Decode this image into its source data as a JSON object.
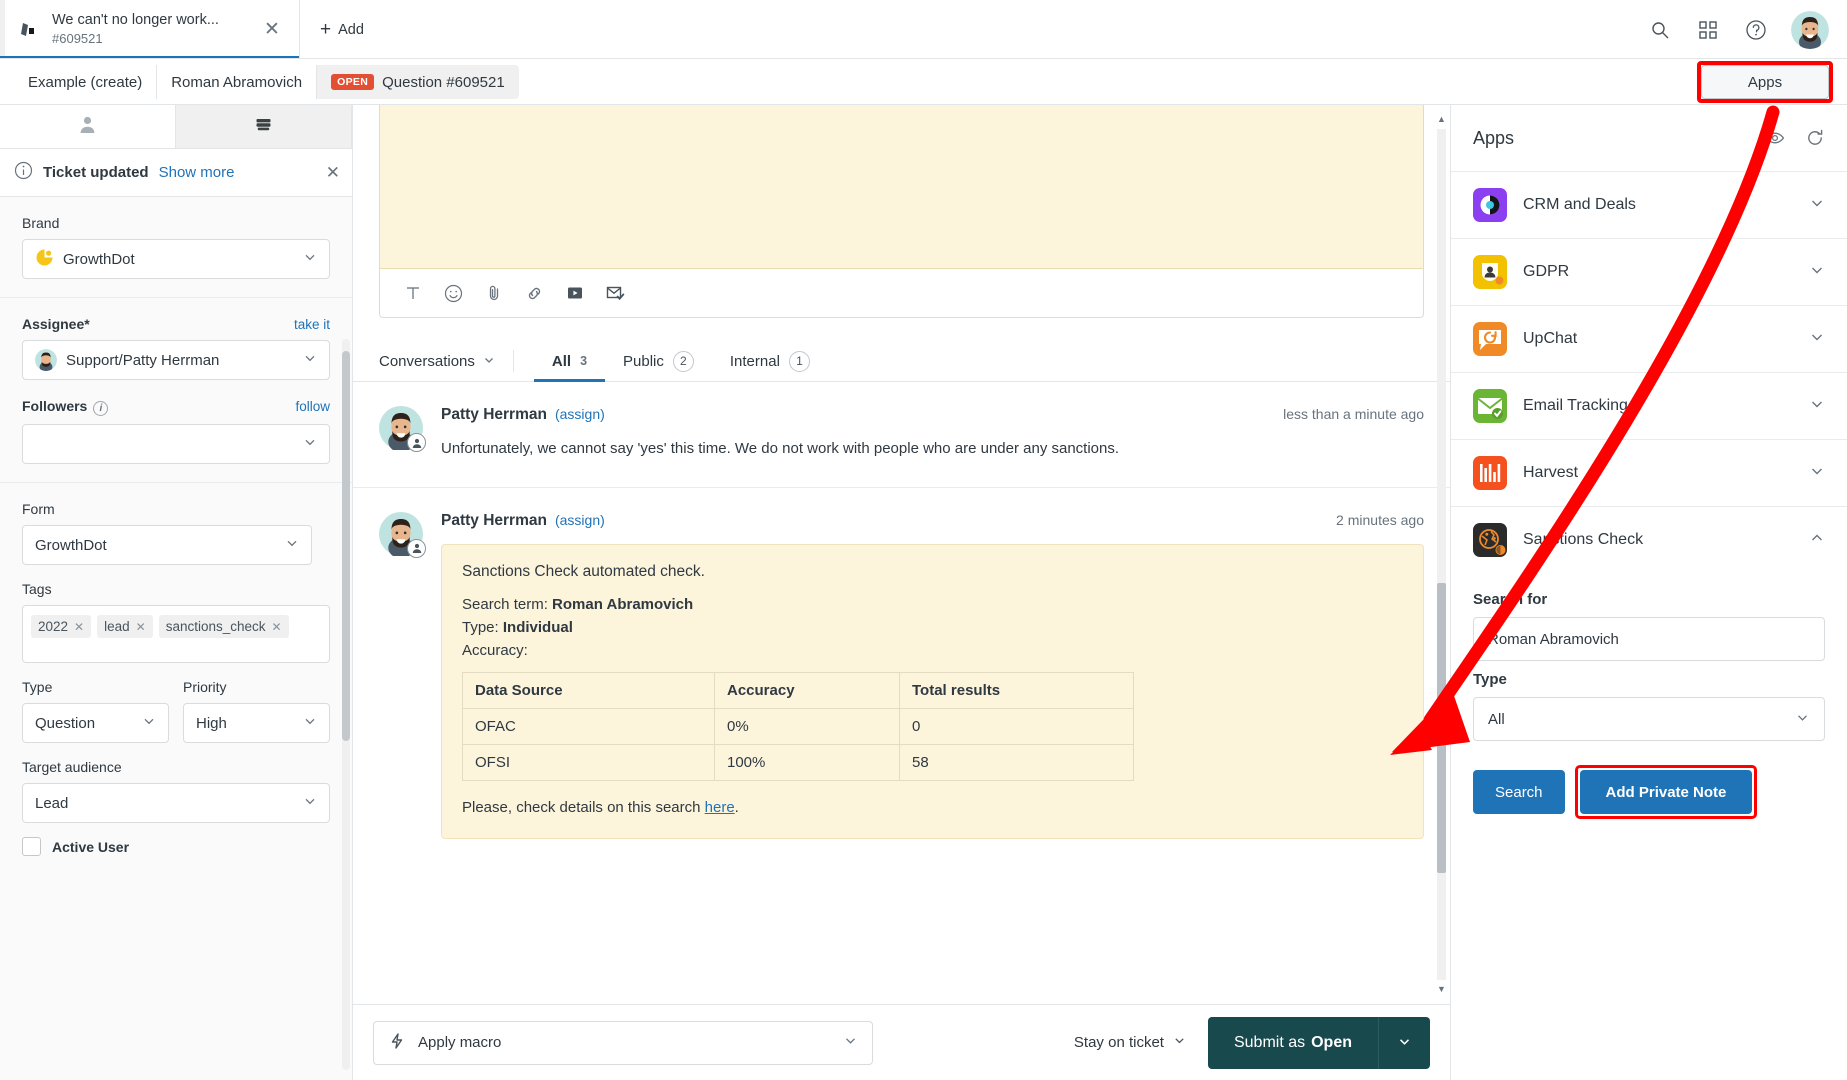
{
  "topbar": {
    "ticket_tab": {
      "title": "We can't no longer work...",
      "number": "#609521",
      "close_icon": "close-icon"
    },
    "add_label": "Add",
    "icons": {
      "search": "search-icon",
      "grid": "grid-icon",
      "help": "help-icon",
      "avatar": "user-avatar"
    }
  },
  "breadcrumb": {
    "items": [
      {
        "label": "Example (create)",
        "badge": "",
        "active": false
      },
      {
        "label": "Roman Abramovich",
        "badge": "",
        "active": false
      },
      {
        "label": "Question #609521",
        "badge": "OPEN",
        "active": true
      }
    ],
    "apps_button": "Apps"
  },
  "left_panel": {
    "tabs": [
      {
        "name": "user-tab",
        "icon": "user-icon",
        "active": false
      },
      {
        "name": "ticket-tab",
        "icon": "ticket-icon",
        "active": true
      }
    ],
    "notice": {
      "title": "Ticket updated",
      "link": "Show more",
      "close": "close-icon"
    },
    "brand": {
      "label": "Brand",
      "value": "GrowthDot"
    },
    "assignee": {
      "label": "Assignee*",
      "action": "take it",
      "value": "Support/Patty Herrman"
    },
    "followers": {
      "label": "Followers",
      "action": "follow",
      "value": ""
    },
    "form": {
      "label": "Form",
      "value": "GrowthDot"
    },
    "tags": {
      "label": "Tags",
      "items": [
        "2022",
        "lead",
        "sanctions_check"
      ]
    },
    "type": {
      "label": "Type",
      "value": "Question"
    },
    "priority": {
      "label": "Priority",
      "value": "High"
    },
    "target_audience": {
      "label": "Target audience",
      "value": "Lead"
    },
    "active_user": {
      "label": "Active User",
      "checked": false
    }
  },
  "center": {
    "composer_tools": [
      "text-format-icon",
      "emoji-icon",
      "attachment-icon",
      "link-icon",
      "video-icon",
      "email-icon"
    ],
    "conversations_label": "Conversations",
    "tabs": [
      {
        "label": "All",
        "count": "3",
        "style": "plain",
        "active": true
      },
      {
        "label": "Public",
        "count": "2",
        "style": "circle",
        "active": false
      },
      {
        "label": "Internal",
        "count": "1",
        "style": "circle",
        "active": false
      }
    ],
    "messages": [
      {
        "author": "Patty Herrman",
        "assign": "(assign)",
        "time": "less than a minute ago",
        "text": "Unfortunately, we cannot say 'yes' this time. We do not work with people who are under any sanctions."
      },
      {
        "author": "Patty Herrman",
        "assign": "(assign)",
        "time": "2 minutes ago",
        "note": {
          "title": "Sanctions Check automated check.",
          "search_term_label": "Search term:",
          "search_term_value": "Roman Abramovich",
          "type_label": "Type:",
          "type_value": "Individual",
          "accuracy_label": "Accuracy:",
          "table": {
            "headers": [
              "Data Source",
              "Accuracy",
              "Total results"
            ],
            "rows": [
              [
                "OFAC",
                "0%",
                "0"
              ],
              [
                "OFSI",
                "100%",
                "58"
              ]
            ]
          },
          "footer_prefix": "Please, check details on this search ",
          "footer_link": "here",
          "footer_suffix": "."
        }
      }
    ]
  },
  "bottombar": {
    "macro_label": "Apply macro",
    "macro_icon": "lightning-icon",
    "stay_label": "Stay on ticket",
    "submit_prefix": "Submit as ",
    "submit_state": "Open"
  },
  "right_panel": {
    "title": "Apps",
    "header_icons": {
      "eye": "eye-icon",
      "refresh": "refresh-icon"
    },
    "apps": [
      {
        "name": "CRM and Deals",
        "icon": "crm-and-deals-icon",
        "color": "#8b3ff0",
        "expanded": false
      },
      {
        "name": "GDPR",
        "icon": "gdpr-icon",
        "color": "#f2c200",
        "expanded": false
      },
      {
        "name": "UpChat",
        "icon": "upchat-icon",
        "color": "#f08a27",
        "expanded": false
      },
      {
        "name": "Email Tracking",
        "icon": "email-tracking-icon",
        "color": "#6bb534",
        "expanded": false
      },
      {
        "name": "Harvest",
        "icon": "harvest-icon",
        "color": "#f4511e",
        "expanded": false
      },
      {
        "name": "Sanctions Check",
        "icon": "sanctions-check-icon",
        "color": "#2b2b2b",
        "expanded": true
      }
    ],
    "sanctions_form": {
      "search_label": "Search for",
      "search_value": "Roman Abramovich",
      "type_label": "Type",
      "type_value": "All",
      "search_button": "Search",
      "add_note_button": "Add Private Note"
    }
  },
  "colors": {
    "accent_blue": "#1f73b7",
    "highlight_red": "#ff0000",
    "open_badge": "#e34f32",
    "note_yellow": "#fdf4dc",
    "submit_green": "#17494d"
  }
}
